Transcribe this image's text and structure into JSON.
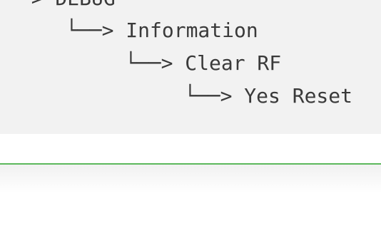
{
  "code_block": {
    "lines": [
      "──> DEBUG",
      "└──> Information",
      "└──> Clear RF",
      "└──> Yes Reset"
    ]
  },
  "colors": {
    "code_background": "#f2f2f2",
    "text": "#3a3a3a",
    "divider": "#5cb85c"
  }
}
